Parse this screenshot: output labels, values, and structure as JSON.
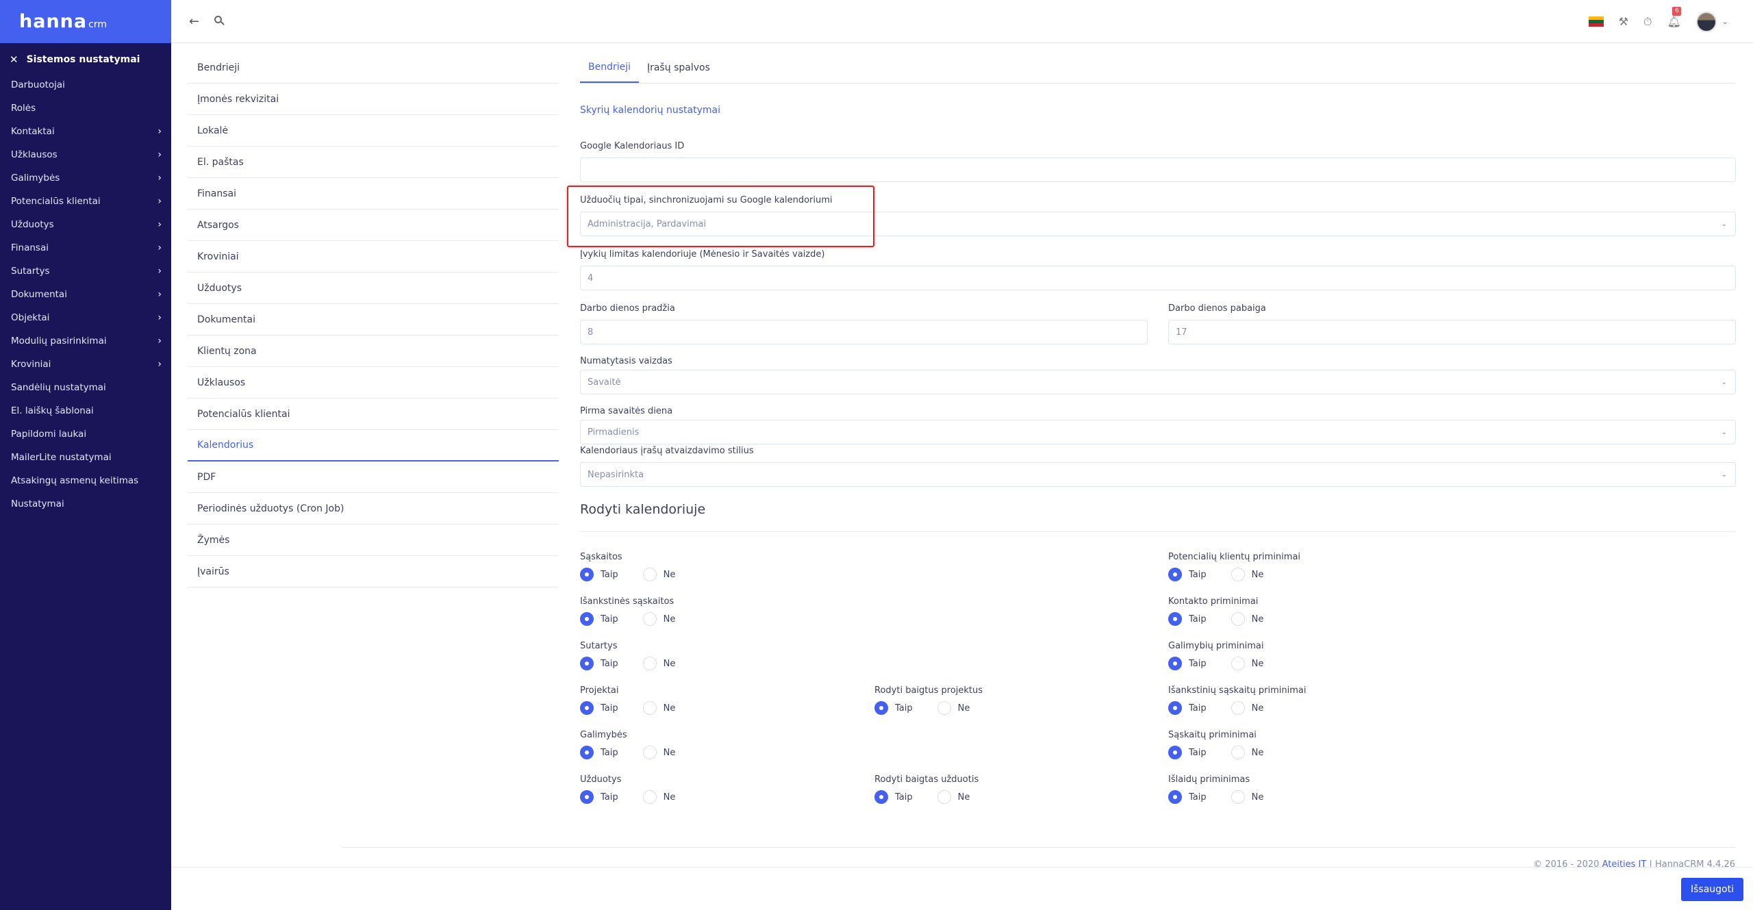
{
  "brand": {
    "logo": "hanna",
    "suffix": "crm"
  },
  "sidebar": {
    "header": "Sistemos nustatymai",
    "items": [
      {
        "label": "Darbuotojai",
        "chevron": false
      },
      {
        "label": "Rolės",
        "chevron": false
      },
      {
        "label": "Kontaktai",
        "chevron": true
      },
      {
        "label": "Užklausos",
        "chevron": true
      },
      {
        "label": "Galimybės",
        "chevron": true
      },
      {
        "label": "Potencialūs klientai",
        "chevron": true
      },
      {
        "label": "Užduotys",
        "chevron": true
      },
      {
        "label": "Finansai",
        "chevron": true
      },
      {
        "label": "Sutartys",
        "chevron": true
      },
      {
        "label": "Dokumentai",
        "chevron": true
      },
      {
        "label": "Objektai",
        "chevron": true
      },
      {
        "label": "Modulių pasirinkimai",
        "chevron": true
      },
      {
        "label": "Kroviniai",
        "chevron": true
      },
      {
        "label": "Sandėlių nustatymai",
        "chevron": false
      },
      {
        "label": "El. laiškų šablonai",
        "chevron": false
      },
      {
        "label": "Papildomi laukai",
        "chevron": false
      },
      {
        "label": "MailerLite nustatymai",
        "chevron": false
      },
      {
        "label": "Atsakingų asmenų keitimas",
        "chevron": false
      },
      {
        "label": "Nustatymai",
        "chevron": false
      }
    ]
  },
  "topbar": {
    "notifications_count": "6",
    "flag_colors": [
      "#fdb913",
      "#006a44",
      "#c1272d"
    ]
  },
  "settings_menu": {
    "items": [
      "Bendrieji",
      "Įmonės rekvizitai",
      "Lokalė",
      "El. paštas",
      "Finansai",
      "Atsargos",
      "Kroviniai",
      "Užduotys",
      "Dokumentai",
      "Klientų zona",
      "Užklausos",
      "Potencialūs klientai",
      "Kalendorius",
      "PDF",
      "Periodinės užduotys (Cron Job)",
      "Žymės",
      "Įvairūs"
    ],
    "active": "Kalendorius"
  },
  "tabs": [
    "Bendrieji",
    "Įrašų spalvos"
  ],
  "sub_link": "Skyrių kalendorių nustatymai",
  "form": {
    "google_id_label": "Google Kalendoriaus ID",
    "google_id_value": "",
    "task_types_label": "Užduočių tipai, sinchronizuojami su Google kalendoriumi",
    "task_types_value": "Administracija, Pardavimai",
    "event_limit_label": "Įvykių limitas kalendoriuje (Mėnesio ir Savaitės vaizde)",
    "event_limit_value": "4",
    "workday_start_label": "Darbo dienos pradžia",
    "workday_start_value": "8",
    "workday_end_label": "Darbo dienos pabaiga",
    "workday_end_value": "17",
    "default_view_label": "Numatytasis vaizdas",
    "default_view_value": "Savaitė",
    "first_day_label": "Pirma savaitės diena",
    "first_day_value": "Pirmadienis",
    "display_style_label": "Kalendoriaus įrašų atvaizdavimo stilius",
    "display_style_value": "Nepasirinkta"
  },
  "show_section": {
    "title": "Rodyti kalendoriuje",
    "yes": "Taip",
    "no": "Ne",
    "col1": [
      {
        "label": "Sąskaitos",
        "value": "Taip"
      },
      {
        "label": "Išankstinės sąskaitos",
        "value": "Taip"
      },
      {
        "label": "Sutartys",
        "value": "Taip"
      },
      {
        "label": "Projektai",
        "value": "Taip"
      },
      {
        "label": "Galimybės",
        "value": "Taip"
      },
      {
        "label": "Užduotys",
        "value": "Taip"
      }
    ],
    "col2": [
      {
        "label": "Rodyti baigtus projektus",
        "value": "Taip"
      },
      {
        "label": "Rodyti baigtas užduotis",
        "value": "Taip"
      }
    ],
    "col3": [
      {
        "label": "Potencialių klientų priminimai",
        "value": "Taip"
      },
      {
        "label": "Kontakto priminimai",
        "value": "Taip"
      },
      {
        "label": "Galimybių priminimai",
        "value": "Taip"
      },
      {
        "label": "Išankstinių sąskaitų priminimai",
        "value": "Taip"
      },
      {
        "label": "Sąskaitų priminimai",
        "value": "Taip"
      },
      {
        "label": "Išlaidų priminimas",
        "value": "Taip"
      }
    ]
  },
  "footer": {
    "copyright_prefix": "© 2016 - 2020",
    "company": "Ateities IT",
    "suffix": "| HannaCRM 4.4.26"
  },
  "save_label": "Išsaugoti"
}
